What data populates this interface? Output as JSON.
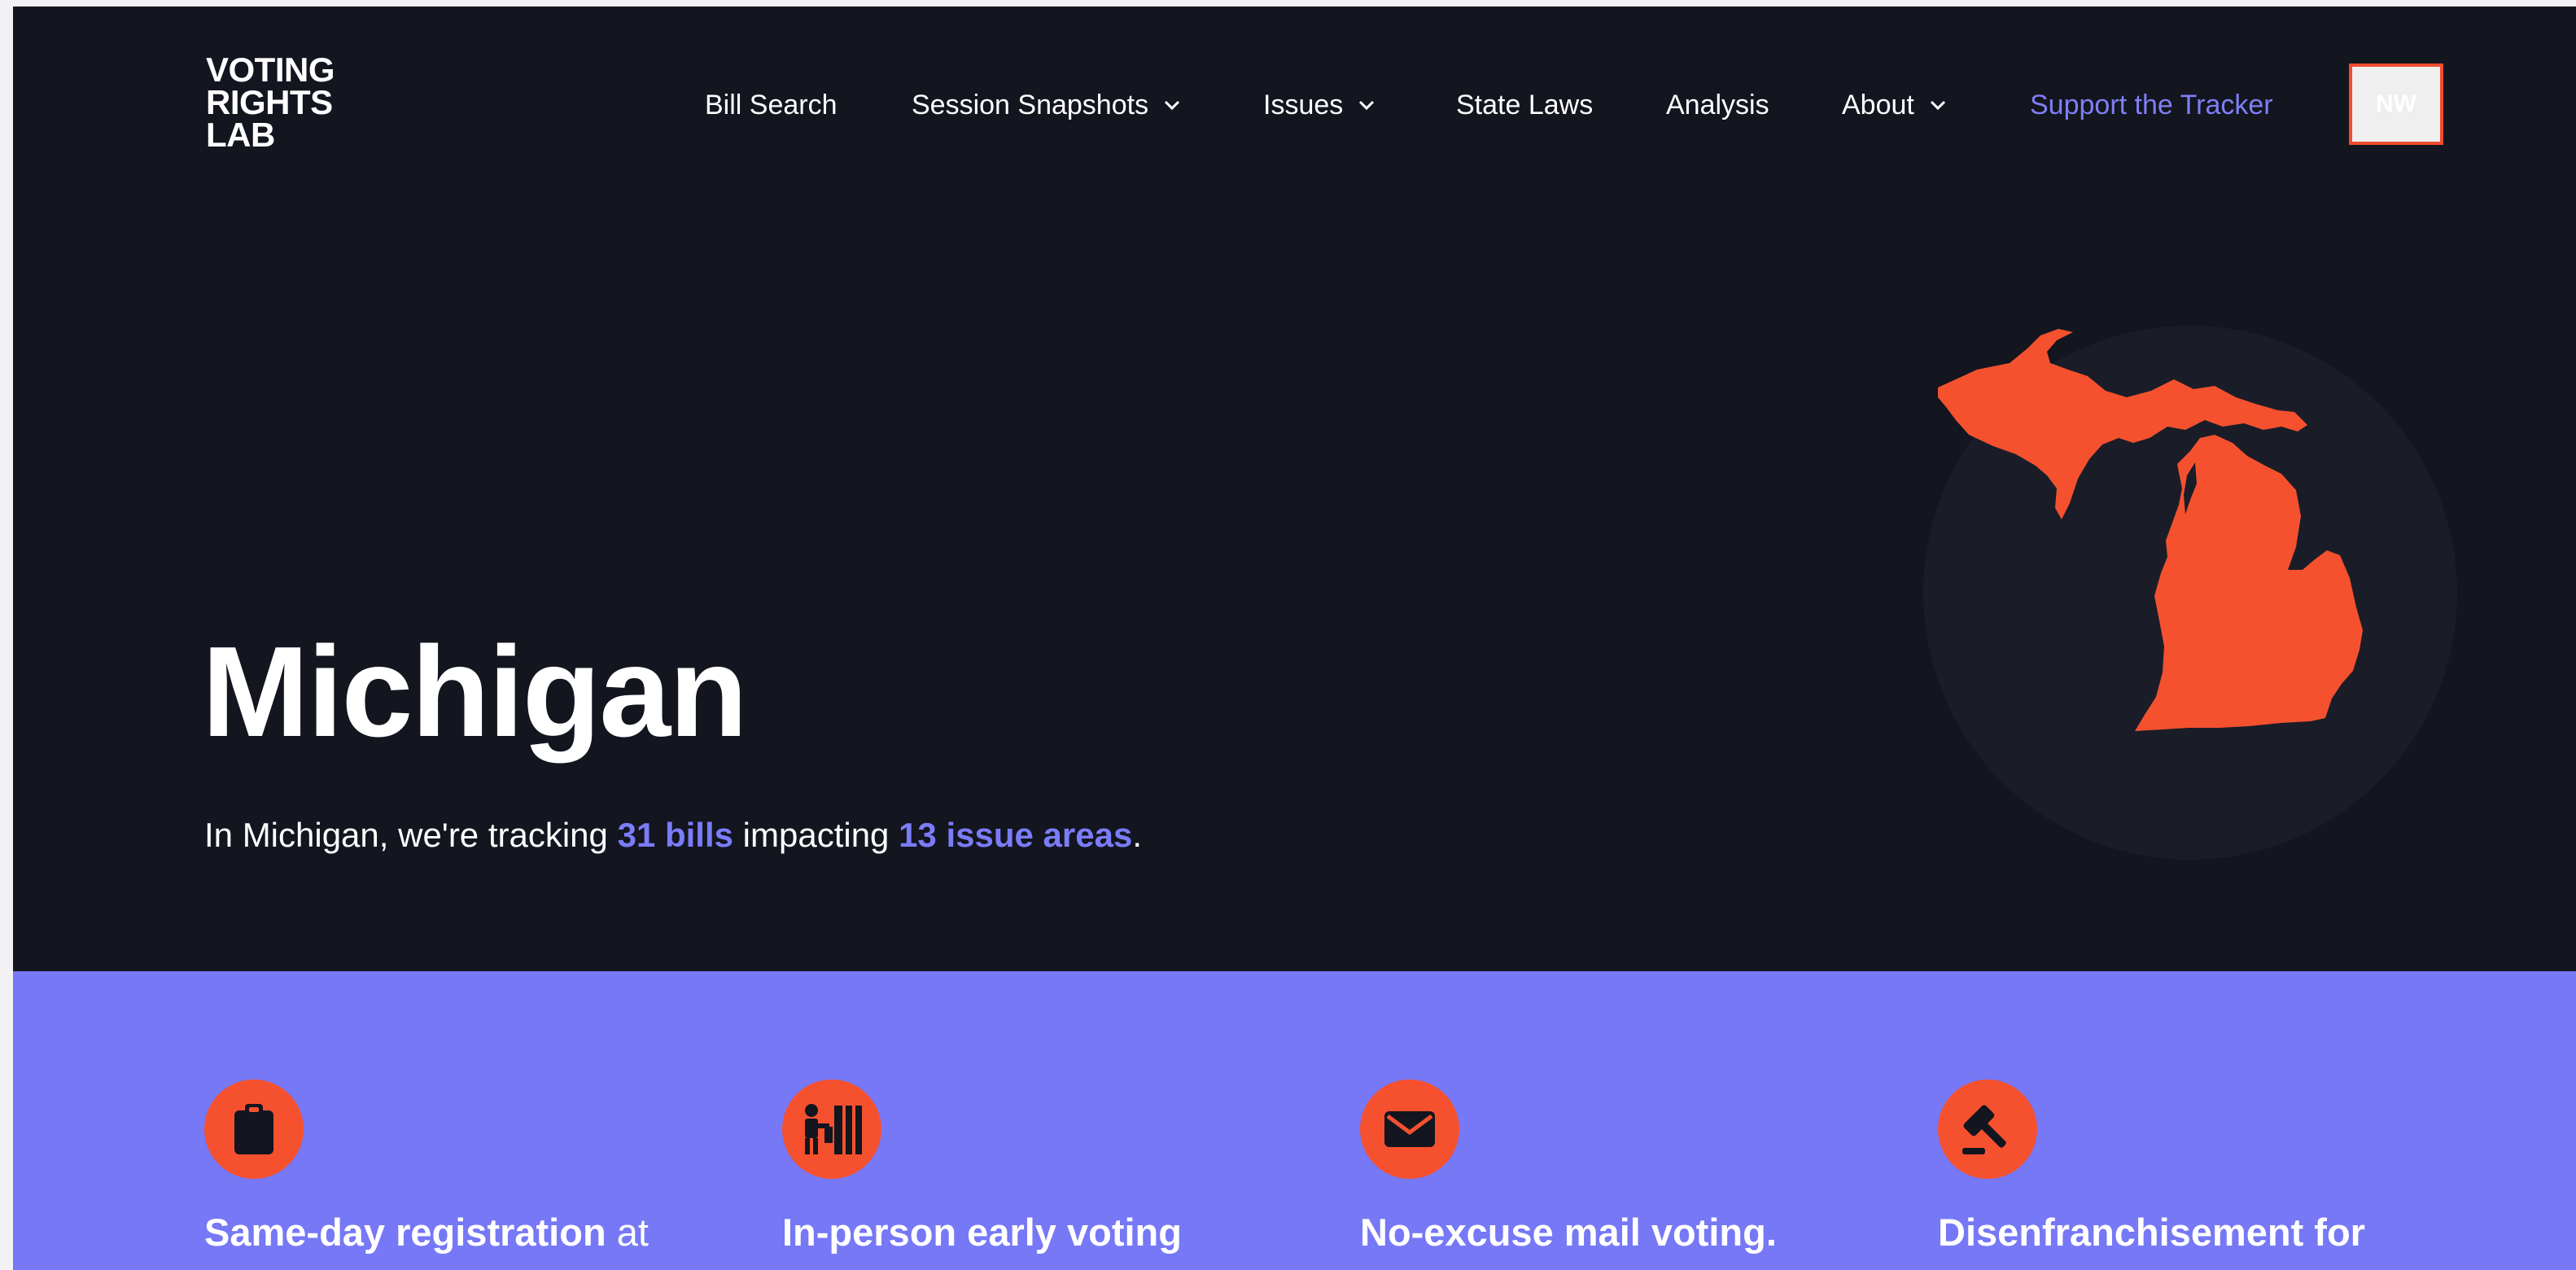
{
  "brand": {
    "logo_lines": [
      "VOTING",
      "RIGHTS",
      "LAB"
    ]
  },
  "nav": {
    "items": [
      {
        "label": "Bill Search",
        "dropdown": false
      },
      {
        "label": "Session Snapshots",
        "dropdown": true
      },
      {
        "label": "Issues",
        "dropdown": true
      },
      {
        "label": "State Laws",
        "dropdown": false
      },
      {
        "label": "Analysis",
        "dropdown": false
      },
      {
        "label": "About",
        "dropdown": true
      }
    ],
    "support_label": "Support the Tracker",
    "user_initials": "NW"
  },
  "hero": {
    "title": "Michigan",
    "summary_prefix": "In Michigan, we're tracking ",
    "bills_link": "31 bills",
    "summary_middle": " impacting ",
    "issues_link": "13 issue areas",
    "summary_suffix": "."
  },
  "issues": [
    {
      "icon": "clipboard-icon",
      "bold": "Same-day registration",
      "rest": " at"
    },
    {
      "icon": "voting-booth-icon",
      "bold": "In-person early voting",
      "rest": ""
    },
    {
      "icon": "envelope-icon",
      "bold": "No-excuse mail voting.",
      "rest": ""
    },
    {
      "icon": "gavel-icon",
      "bold": "Disenfranchisement for",
      "rest": ""
    }
  ],
  "colors": {
    "hero_bg": "#13151f",
    "accent_orange": "#f5512f",
    "accent_purple": "#7678f6",
    "link_purple": "#7b7cf8"
  }
}
